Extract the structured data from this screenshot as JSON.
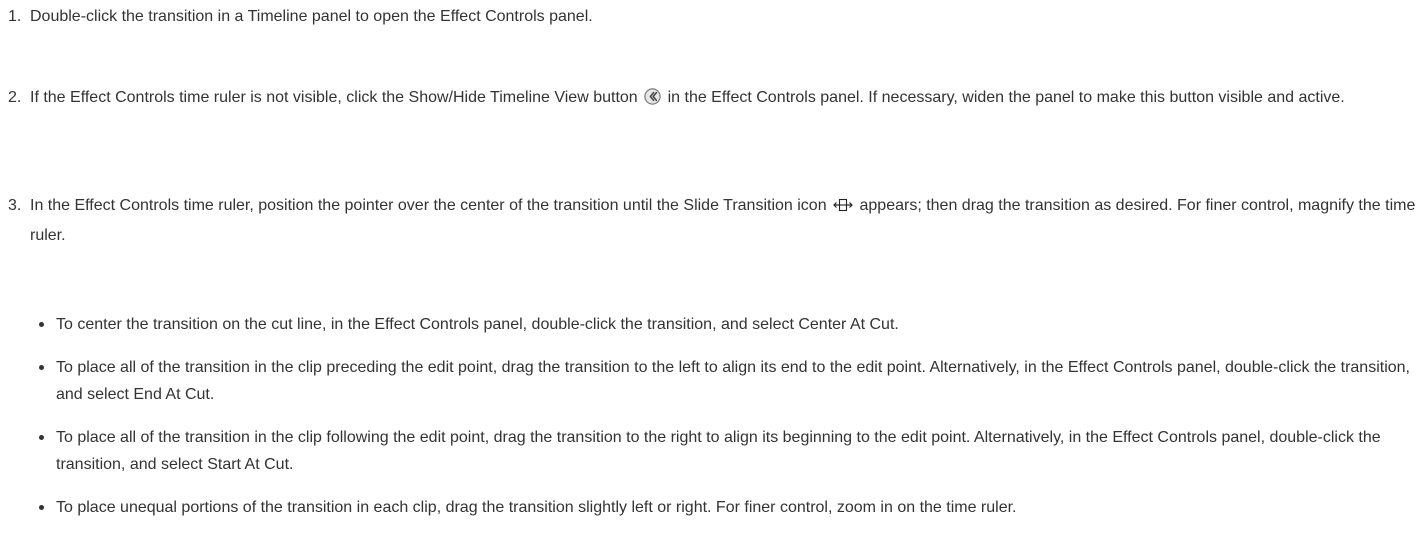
{
  "steps": [
    {
      "number": "1.",
      "text": "Double-click the transition in a Timeline panel to open the Effect Controls panel."
    },
    {
      "number": "2.",
      "text_before_icon": "If the Effect Controls time ruler is not visible, click the Show/Hide Timeline View button",
      "icon": "show-hide-timeline-view-icon",
      "text_after_icon": "in the Effect Controls panel. If necessary, widen the panel to make this button visible and active."
    },
    {
      "number": "3.",
      "text_before_icon": "In the Effect Controls time ruler, position the pointer over the center of the transition until the Slide Transition icon",
      "icon": "slide-transition-icon",
      "text_after_icon": "appears; then drag the transition as desired. For finer control, magnify the time ruler."
    }
  ],
  "bullets": [
    "To center the transition on the cut line, in the Effect Controls panel, double-click the transition, and select Center At Cut.",
    "To place all of the transition in the clip preceding the edit point, drag the transition to the left to align its end to the edit point. Alternatively, in the Effect Controls panel, double-click the transition, and select End At Cut.",
    "To place all of the transition in the clip following the edit point, drag the transition to the right to align its beginning to the edit point. Alternatively, in the Effect Controls panel, double-click the transition, and select Start At Cut.",
    "To place unequal portions of the transition in each clip, drag the transition slightly left or right. For finer control, zoom in on the time ruler."
  ],
  "colors": {
    "text": "#333333",
    "background": "#ffffff"
  }
}
